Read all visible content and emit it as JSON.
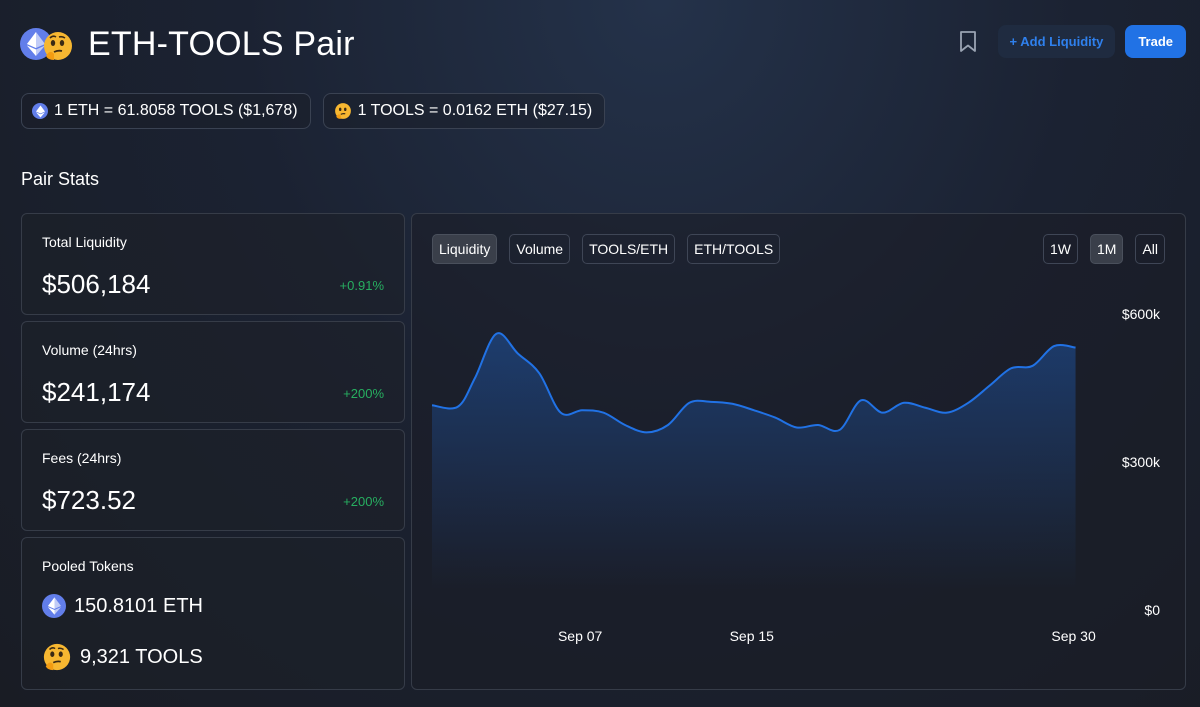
{
  "header": {
    "title": "ETH-TOOLS Pair",
    "add_liquidity_label": "+ Add Liquidity",
    "trade_label": "Trade"
  },
  "rates": [
    {
      "text": "1 ETH = 61.8058 TOOLS ($1,678)"
    },
    {
      "text": "1 TOOLS = 0.0162 ETH ($27.15)"
    }
  ],
  "pair_stats": {
    "title": "Pair Stats",
    "cards": [
      {
        "label": "Total Liquidity",
        "value": "$506,184",
        "change": "+0.91%"
      },
      {
        "label": "Volume (24hrs)",
        "value": "$241,174",
        "change": "+200%"
      },
      {
        "label": "Fees (24hrs)",
        "value": "$723.52",
        "change": "+200%"
      }
    ],
    "pooled": {
      "label": "Pooled Tokens",
      "eth": "150.8101 ETH",
      "tools": "9,321 TOOLS"
    }
  },
  "chart": {
    "tabs": [
      "Liquidity",
      "Volume",
      "TOOLS/ETH",
      "ETH/TOOLS"
    ],
    "active_tab": "Liquidity",
    "ranges": [
      "1W",
      "1M",
      "All"
    ],
    "active_range": "1M",
    "line_color": "#2172e5"
  },
  "chart_data": {
    "type": "area",
    "title": "",
    "xlabel": "",
    "ylabel": "",
    "ylim": [
      0,
      600000
    ],
    "y_ticks": [
      "$0",
      "$300k",
      "$600k"
    ],
    "x_ticks": [
      {
        "x": 7,
        "label": "Sep 07"
      },
      {
        "x": 15,
        "label": "Sep 15"
      },
      {
        "x": 30,
        "label": "Sep 30"
      }
    ],
    "xlim": [
      0,
      31
    ],
    "series": [
      {
        "values": [
          [
            0,
            415000
          ],
          [
            1.2,
            412000
          ],
          [
            2,
            470000
          ],
          [
            3,
            560000
          ],
          [
            4,
            520000
          ],
          [
            5,
            480000
          ],
          [
            6,
            400000
          ],
          [
            7,
            405000
          ],
          [
            8,
            400000
          ],
          [
            9,
            375000
          ],
          [
            10,
            360000
          ],
          [
            11,
            375000
          ],
          [
            12,
            420000
          ],
          [
            13,
            422000
          ],
          [
            14,
            418000
          ],
          [
            15,
            405000
          ],
          [
            16,
            390000
          ],
          [
            17,
            370000
          ],
          [
            18,
            375000
          ],
          [
            19,
            365000
          ],
          [
            20,
            425000
          ],
          [
            21,
            400000
          ],
          [
            22,
            420000
          ],
          [
            23,
            410000
          ],
          [
            24,
            400000
          ],
          [
            25,
            420000
          ],
          [
            26,
            455000
          ],
          [
            27,
            490000
          ],
          [
            28,
            495000
          ],
          [
            29,
            535000
          ],
          [
            30,
            532000
          ]
        ]
      }
    ]
  }
}
